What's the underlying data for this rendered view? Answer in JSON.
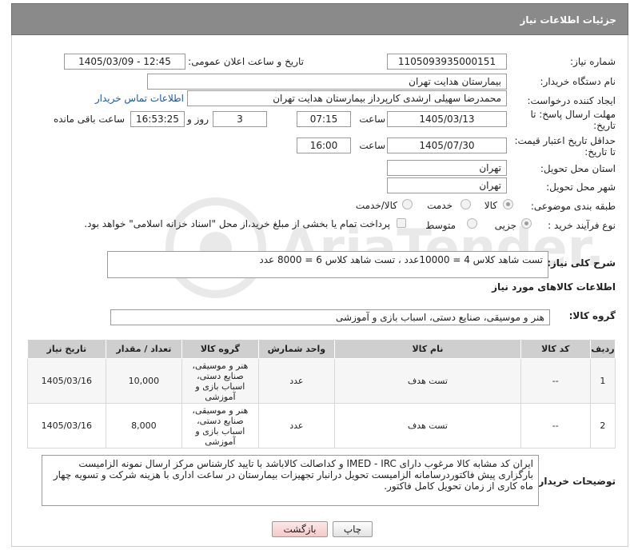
{
  "header": {
    "title": "جزئیات اطلاعات نیاز"
  },
  "form": {
    "need_number_label": "شماره نیاز:",
    "need_number": "1105093935000151",
    "announce_label": "تاریخ و ساعت اعلان عمومی:",
    "announce_value": "1405/03/09 - 12:45",
    "buyer_org_label": "نام دستگاه خریدار:",
    "buyer_org": "بیمارستان هدایت تهران",
    "creator_label": "ایجاد کننده درخواست:",
    "creator": "محمدرضا سهیلی ارشدی کارپرداز بیمارستان هدایت تهران",
    "contact_link": "اطلاعات تماس خریدار",
    "deadline_label_1": "مهلت ارسال پاسخ: تا",
    "deadline_label_2": "تاریخ:",
    "deadline_date": "1405/03/13",
    "time_label": "ساعت",
    "deadline_time": "07:15",
    "days_value": "3",
    "days_label": "روز و",
    "remaining_time": "16:53:25",
    "remaining_label": "ساعت باقی مانده",
    "validity_label_1": "حداقل تاریخ اعتبار قیمت:",
    "validity_label_2": "تا تاریخ:",
    "validity_date": "1405/07/30",
    "validity_time": "16:00",
    "province_label": "استان محل تحویل:",
    "province": "تهران",
    "city_label": "شهر محل تحویل:",
    "city": "تهران",
    "category_label": "طبقه بندی موضوعی:",
    "category_options": [
      "کالا",
      "خدمت",
      "کالا/خدمت"
    ],
    "category_selected": "کالا",
    "process_label": "نوع فرآیند خرید :",
    "process_options": [
      "جزیی",
      "متوسط"
    ],
    "process_selected": "جزیی",
    "payment_note": "پرداخت تمام یا بخشی از مبلغ خرید،از محل \"اسناد خزانه اسلامی\" خواهد بود.",
    "summary_label": "شرح کلی نیاز:",
    "summary": "تست شاهد کلاس 4 = 10000عدد ، تست شاهد کلاس 6 = 8000 عدد"
  },
  "goods": {
    "section_title": "اطلاعات کالاهای مورد نیاز",
    "group_label": "گروه کالا:",
    "group_value": "هنر و موسیقی، صنایع دستی، اسباب بازی و آموزشی",
    "columns": [
      "ردیف",
      "کد کالا",
      "نام کالا",
      "واحد شمارش",
      "گروه کالا",
      "تعداد / مقدار",
      "تاریخ نیاز"
    ],
    "rows": [
      {
        "row": "1",
        "code": "--",
        "name": "تست هدف",
        "unit": "عدد",
        "group": "هنر و موسیقی، صنایع دستی، اسباب بازی و آموزشی",
        "qty": "10,000",
        "date": "1405/03/16"
      },
      {
        "row": "2",
        "code": "--",
        "name": "تست هدف",
        "unit": "عدد",
        "group": "هنر و موسیقی، صنایع دستی، اسباب بازی و آموزشی",
        "qty": "8,000",
        "date": "1405/03/16"
      }
    ]
  },
  "notes": {
    "label": "توضیحات خریدار:",
    "text": "ایران کد مشابه کالا مرغوب دارای IMED - IRC و کداصالت کالاباشد با تایید کارشناس مرکز ارسال نمونه الزامیست بارگزاری پیش فاکتوردرسامانه الزامیست تحویل درانبار تجهیزات بیمارستان در ساعت اداری با هزینه شرکت و تسویه چهار ماه کاری از زمان تحویل کامل فاکتور."
  },
  "buttons": {
    "print": "چاپ",
    "back": "بازگشت"
  },
  "colors": {
    "header_bg": "#8a8a8a",
    "link": "#1a57b5",
    "table_header": "#cfcfcf"
  }
}
